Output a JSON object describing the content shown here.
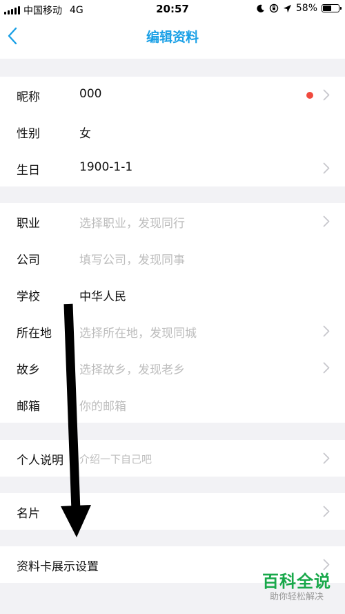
{
  "status_bar": {
    "carrier": "中国移动",
    "network": "4G",
    "time": "20:57",
    "battery_percent": "58%",
    "battery_level": 0.58,
    "icons": [
      "moon-icon",
      "orientation-lock-icon",
      "location-arrow-icon"
    ]
  },
  "nav": {
    "title": "编辑资料",
    "back_icon": "chevron-left-icon",
    "accent": "#1aa0e6"
  },
  "basic": {
    "nickname": {
      "label": "昵称",
      "value": "000"
    },
    "gender": {
      "label": "性别",
      "value": "女"
    },
    "birthday": {
      "label": "生日",
      "value": "1900-1-1"
    }
  },
  "profile": {
    "occupation": {
      "label": "职业",
      "placeholder": "选择职业，发现同行"
    },
    "company": {
      "label": "公司",
      "placeholder": "填写公司，发现同事"
    },
    "school": {
      "label": "学校",
      "value": "中华人民"
    },
    "location": {
      "label": "所在地",
      "placeholder": "选择所在地，发现同城"
    },
    "hometown": {
      "label": "故乡",
      "placeholder": "选择故乡，发现老乡"
    },
    "email": {
      "label": "邮箱",
      "placeholder": "你的邮箱"
    }
  },
  "about": {
    "label": "个人说明",
    "placeholder": "介绍一下自己吧"
  },
  "card": {
    "label": "名片"
  },
  "card_display": {
    "label": "资料卡展示设置"
  },
  "watermark": {
    "title": "百科全说",
    "subtitle": "助你轻松解决"
  },
  "colors": {
    "badge_dot": "#f04a3e",
    "watermark": "#18a84a",
    "placeholder": "#bdbdbd"
  }
}
